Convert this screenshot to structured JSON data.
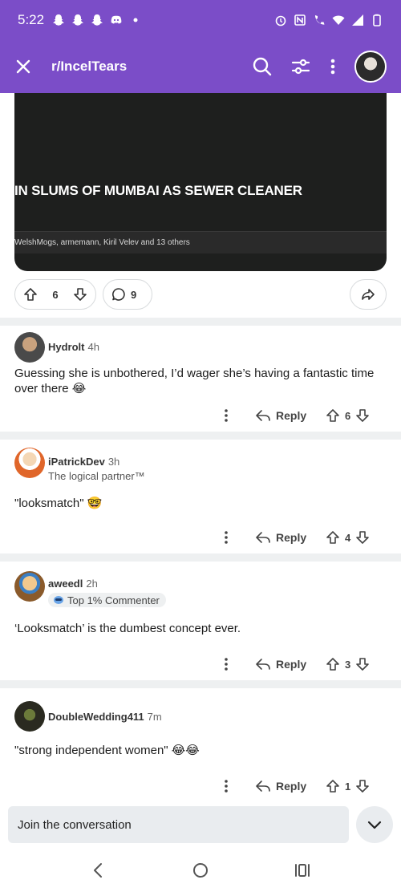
{
  "status_bar": {
    "time": "5:22",
    "left_icons": [
      "snapchat-icon",
      "snapchat-icon",
      "snapchat-icon",
      "discord-icon",
      "dot-icon"
    ],
    "right_icons": [
      "alarm-icon",
      "nfc-icon",
      "wifi-calling-icon",
      "wifi-icon",
      "signal-icon",
      "battery-icon"
    ]
  },
  "app_bar": {
    "title": "r/IncelTears",
    "close_icon": "close-icon",
    "actions": [
      "search-icon",
      "filter-icon",
      "more-vertical-icon",
      "avatar"
    ]
  },
  "post": {
    "image_caption": "IN SLUMS OF MUMBAI AS SEWER CLEANER",
    "image_strip_text": "WelshMogs, armemann, Kiril Velev and 13 others",
    "upvotes": "6",
    "comments": "9"
  },
  "comments": [
    {
      "user": "Hydrolt",
      "time": "4h",
      "flair": "",
      "badge": "",
      "body": "Guessing she is unbothered, I’d wager she’s having a fantastic time over there 😂",
      "reply_label": "Reply",
      "votes": "6"
    },
    {
      "user": "iPatrickDev",
      "time": "3h",
      "flair": "The logical partner™",
      "badge": "",
      "body": "\"looksmatch\" 🤓",
      "reply_label": "Reply",
      "votes": "4"
    },
    {
      "user": "aweedl",
      "time": "2h",
      "flair": "",
      "badge": "Top 1% Commenter",
      "body": "‘Looksmatch’ is the dumbest concept ever.",
      "reply_label": "Reply",
      "votes": "3"
    },
    {
      "user": "DoubleWedding411",
      "time": "7m",
      "flair": "",
      "badge": "",
      "body": "\"strong independent women\" 😂😂",
      "reply_label": "Reply",
      "votes": "1"
    }
  ],
  "compose": {
    "placeholder": "Join the conversation"
  },
  "colors": {
    "brand": "#7b4dc8",
    "separator": "#eef0f1"
  }
}
